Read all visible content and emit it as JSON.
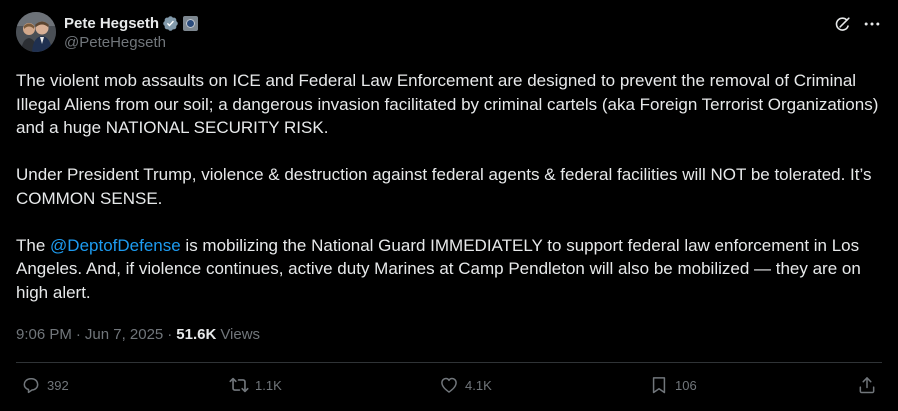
{
  "author": {
    "display_name": "Pete Hegseth",
    "handle": "@PeteHegseth"
  },
  "tweet": {
    "paragraphs": [
      {
        "text": "The violent mob assaults on ICE and Federal Law Enforcement are designed to prevent the removal of Criminal Illegal Aliens from our soil; a dangerous invasion facilitated by criminal cartels (aka Foreign Terrorist Organizations) and a huge NATIONAL SECURITY RISK."
      },
      {
        "text": "Under President Trump, violence & destruction against federal agents & federal facilities will NOT be tolerated. It’s COMMON SENSE."
      },
      {
        "before": "The ",
        "mention": "@DeptofDefense",
        "after": " is mobilizing the National Guard IMMEDIATELY to support federal law enforcement in Los Angeles. And, if violence continues, active duty Marines at Camp Pendleton will also be mobilized — they are on high alert."
      }
    ]
  },
  "meta": {
    "time": "9:06 PM",
    "separator": "·",
    "date": "Jun 7, 2025",
    "views_count": "51.6K",
    "views_label": "Views"
  },
  "actions": {
    "replies": "392",
    "retweets": "1.1K",
    "likes": "4.1K",
    "bookmarks": "106"
  },
  "icons": {
    "verified": "verified-badge-icon",
    "affiliation": "government-affiliation-icon",
    "grok": "grok-icon",
    "more": "more-icon",
    "reply": "reply-icon",
    "retweet": "retweet-icon",
    "like": "heart-icon",
    "bookmark": "bookmark-icon",
    "share": "share-icon"
  },
  "colors": {
    "background": "#000000",
    "text": "#e7e9ea",
    "secondary": "#71767b",
    "accent": "#1d9bf0",
    "verified_badge": "#829aab",
    "divider": "#2f3336"
  }
}
